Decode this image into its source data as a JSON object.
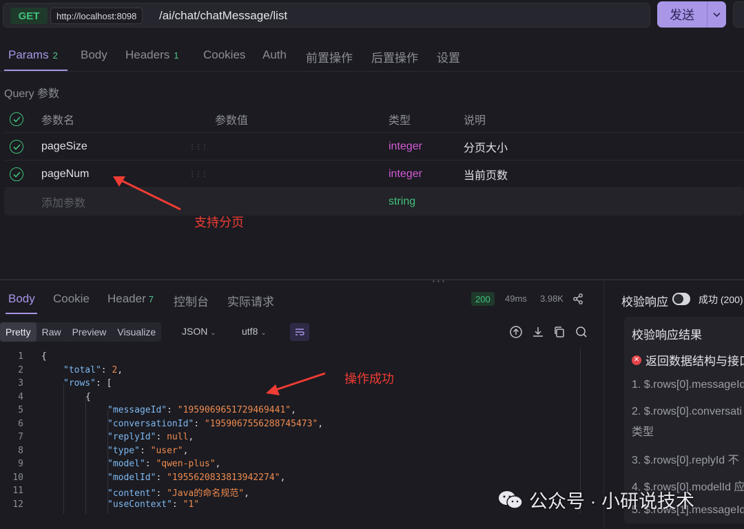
{
  "request": {
    "method": "GET",
    "host": "http://localhost:8098",
    "path": "/ai/chat/chatMessage/list",
    "send_label": "发送"
  },
  "tabs": [
    {
      "label": "Params",
      "count": "2"
    },
    {
      "label": "Body"
    },
    {
      "label": "Headers",
      "count": "1"
    },
    {
      "label": "Cookies"
    },
    {
      "label": "Auth"
    },
    {
      "label": "前置操作"
    },
    {
      "label": "后置操作"
    },
    {
      "label": "设置"
    }
  ],
  "query_label": "Query 参数",
  "params": {
    "headers": [
      "参数名",
      "参数值",
      "类型",
      "说明"
    ],
    "rows": [
      {
        "name": "pageSize",
        "type": "integer",
        "desc": "分页大小"
      },
      {
        "name": "pageNum",
        "type": "integer",
        "desc": "当前页数"
      }
    ],
    "add_placeholder": "添加参数",
    "add_type": "string"
  },
  "annotations": {
    "pagination": "支持分页",
    "success": "操作成功"
  },
  "response": {
    "tabs": [
      {
        "label": "Body"
      },
      {
        "label": "Cookie"
      },
      {
        "label": "Header",
        "count": "7"
      },
      {
        "label": "控制台"
      },
      {
        "label": "实际请求"
      }
    ],
    "status": "200",
    "time": "49ms",
    "size": "3.98K",
    "formats": [
      "Pretty",
      "Raw",
      "Preview",
      "Visualize"
    ],
    "lang": "JSON",
    "encoding": "utf8"
  },
  "code_lines": [
    {
      "n": "1",
      "indent": 0,
      "parts": [
        [
          "p",
          "{"
        ]
      ]
    },
    {
      "n": "2",
      "indent": 1,
      "parts": [
        [
          "k",
          "\"total\""
        ],
        [
          "p",
          ": "
        ],
        [
          "n",
          "2"
        ],
        [
          "p",
          ","
        ]
      ]
    },
    {
      "n": "3",
      "indent": 1,
      "parts": [
        [
          "k",
          "\"rows\""
        ],
        [
          "p",
          ": ["
        ]
      ]
    },
    {
      "n": "4",
      "indent": 2,
      "parts": [
        [
          "p",
          "{"
        ]
      ]
    },
    {
      "n": "5",
      "indent": 3,
      "parts": [
        [
          "k",
          "\"messageId\""
        ],
        [
          "p",
          ": "
        ],
        [
          "s",
          "\"1959069651729469441\""
        ],
        [
          "p",
          ","
        ]
      ]
    },
    {
      "n": "6",
      "indent": 3,
      "parts": [
        [
          "k",
          "\"conversationId\""
        ],
        [
          "p",
          ": "
        ],
        [
          "s",
          "\"1959067556288745473\""
        ],
        [
          "p",
          ","
        ]
      ]
    },
    {
      "n": "7",
      "indent": 3,
      "parts": [
        [
          "k",
          "\"replyId\""
        ],
        [
          "p",
          ": "
        ],
        [
          "n",
          "null"
        ],
        [
          "p",
          ","
        ]
      ]
    },
    {
      "n": "8",
      "indent": 3,
      "parts": [
        [
          "k",
          "\"type\""
        ],
        [
          "p",
          ": "
        ],
        [
          "s",
          "\"user\""
        ],
        [
          "p",
          ","
        ]
      ]
    },
    {
      "n": "9",
      "indent": 3,
      "parts": [
        [
          "k",
          "\"model\""
        ],
        [
          "p",
          ": "
        ],
        [
          "s",
          "\"qwen-plus\""
        ],
        [
          "p",
          ","
        ]
      ]
    },
    {
      "n": "10",
      "indent": 3,
      "parts": [
        [
          "k",
          "\"modelId\""
        ],
        [
          "p",
          ": "
        ],
        [
          "s",
          "\"1955620833813942274\""
        ],
        [
          "p",
          ","
        ]
      ]
    },
    {
      "n": "11",
      "indent": 3,
      "parts": [
        [
          "k",
          "\"content\""
        ],
        [
          "p",
          ": "
        ],
        [
          "s",
          "\"Java的命名规范\""
        ],
        [
          "p",
          ","
        ]
      ]
    },
    {
      "n": "12",
      "indent": 3,
      "parts": [
        [
          "k",
          "\"useContext\""
        ],
        [
          "p",
          ": "
        ],
        [
          "s",
          "\"1\""
        ]
      ]
    }
  ],
  "validation": {
    "title": "校验响应",
    "status": "成功 (200)",
    "box_title": "校验响应结果",
    "error": "返回数据结构与接口",
    "items": [
      "1. $.rows[0].messageId",
      "2. $.rows[0].conversati",
      "类型",
      "3. $.rows[0].replyId 不",
      "4. $.rows[0].modelId 应",
      "5. $.rows[1].messageId"
    ]
  },
  "watermark": "公众号 · 小研说技术",
  "colors": {
    "accent": "#a996e6",
    "success": "#42c27a",
    "type_integer": "#d35bd5",
    "annotation": "#ef3c34"
  }
}
